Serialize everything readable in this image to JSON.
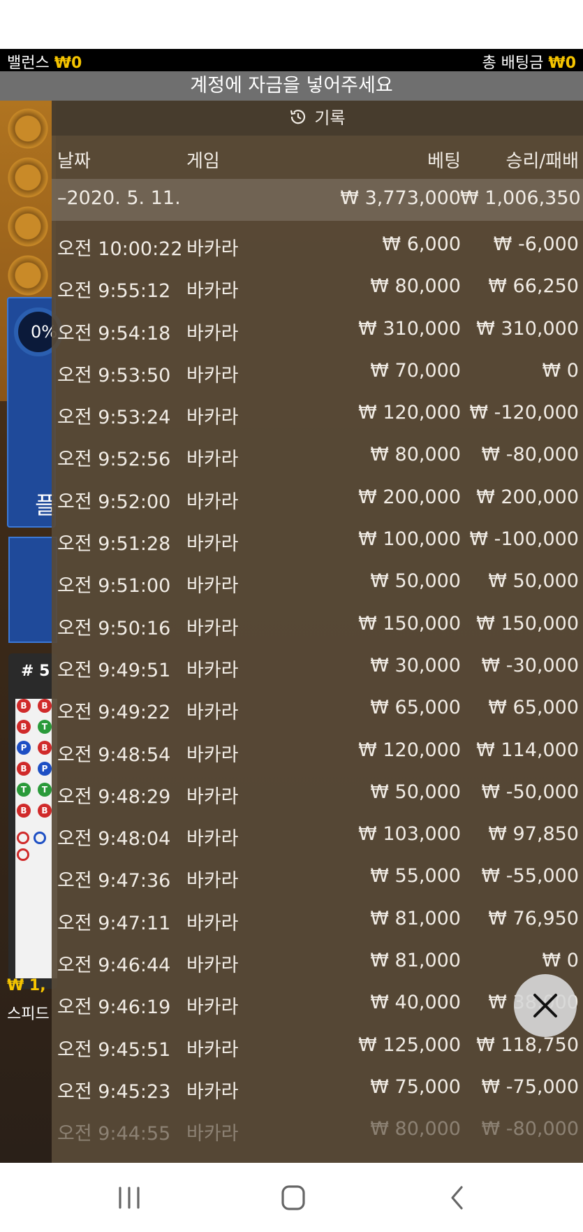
{
  "balance_bar": {
    "balance_label": "밸런스",
    "balance_value": "₩0",
    "total_bet_label": "총 배팅금",
    "total_bet_value": "₩0"
  },
  "notice": "계정에 자금을 넣어주세요",
  "history": {
    "title": "기록",
    "icon": "history-clock-icon",
    "columns": {
      "date": "날짜",
      "game": "게임",
      "bet": "베팅",
      "result": "승리/패배"
    },
    "summary": {
      "date": "–2020. 5. 11.",
      "bet": "₩ 3,773,000",
      "result": "₩ 1,006,350"
    },
    "rows": [
      {
        "time": "오전 10:00:22",
        "game": "바카라",
        "bet": "₩ 6,000",
        "result": "₩ -6,000"
      },
      {
        "time": "오전 9:55:12",
        "game": "바카라",
        "bet": "₩ 80,000",
        "result": "₩ 66,250"
      },
      {
        "time": "오전 9:54:18",
        "game": "바카라",
        "bet": "₩ 310,000",
        "result": "₩ 310,000"
      },
      {
        "time": "오전 9:53:50",
        "game": "바카라",
        "bet": "₩ 70,000",
        "result": "₩ 0"
      },
      {
        "time": "오전 9:53:24",
        "game": "바카라",
        "bet": "₩ 120,000",
        "result": "₩ -120,000"
      },
      {
        "time": "오전 9:52:56",
        "game": "바카라",
        "bet": "₩ 80,000",
        "result": "₩ -80,000"
      },
      {
        "time": "오전 9:52:00",
        "game": "바카라",
        "bet": "₩ 200,000",
        "result": "₩ 200,000"
      },
      {
        "time": "오전 9:51:28",
        "game": "바카라",
        "bet": "₩ 100,000",
        "result": "₩ -100,000"
      },
      {
        "time": "오전 9:51:00",
        "game": "바카라",
        "bet": "₩ 50,000",
        "result": "₩ 50,000"
      },
      {
        "time": "오전 9:50:16",
        "game": "바카라",
        "bet": "₩ 150,000",
        "result": "₩ 150,000"
      },
      {
        "time": "오전 9:49:51",
        "game": "바카라",
        "bet": "₩ 30,000",
        "result": "₩ -30,000"
      },
      {
        "time": "오전 9:49:22",
        "game": "바카라",
        "bet": "₩ 65,000",
        "result": "₩ 65,000"
      },
      {
        "time": "오전 9:48:54",
        "game": "바카라",
        "bet": "₩ 120,000",
        "result": "₩ 114,000"
      },
      {
        "time": "오전 9:48:29",
        "game": "바카라",
        "bet": "₩ 50,000",
        "result": "₩ -50,000"
      },
      {
        "time": "오전 9:48:04",
        "game": "바카라",
        "bet": "₩ 103,000",
        "result": "₩ 97,850"
      },
      {
        "time": "오전 9:47:36",
        "game": "바카라",
        "bet": "₩ 55,000",
        "result": "₩ -55,000"
      },
      {
        "time": "오전 9:47:11",
        "game": "바카라",
        "bet": "₩ 81,000",
        "result": "₩ 76,950"
      },
      {
        "time": "오전 9:46:44",
        "game": "바카라",
        "bet": "₩ 81,000",
        "result": "₩ 0"
      },
      {
        "time": "오전 9:46:19",
        "game": "바카라",
        "bet": "₩ 40,000",
        "result": "₩ 38,000"
      },
      {
        "time": "오전 9:45:51",
        "game": "바카라",
        "bet": "₩ 125,000",
        "result": "₩ 118,750"
      },
      {
        "time": "오전 9:45:23",
        "game": "바카라",
        "bet": "₩ 75,000",
        "result": "₩ -75,000"
      },
      {
        "time": "오전 9:44:55",
        "game": "바카라",
        "bet": "₩ 80,000",
        "result": "₩ -80,000"
      }
    ]
  },
  "background": {
    "percent_badge": "0%",
    "player_label": "플",
    "road_label": "# 5",
    "bottom_amount": "₩ 1,",
    "bottom_table_label": "스피드"
  },
  "close_button_icon": "close-icon",
  "nav": {
    "recents_icon": "recent-apps-icon",
    "home_icon": "home-icon",
    "back_icon": "back-icon"
  },
  "colors": {
    "gold": "#f5c400",
    "panel": "#584a38",
    "balance_bar": "#000000",
    "notice_bar": "#6f6f6f"
  }
}
